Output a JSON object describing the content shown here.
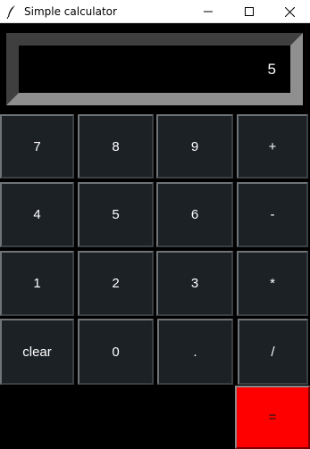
{
  "window": {
    "title": "Simple calculator"
  },
  "display": {
    "value": "5"
  },
  "keys": {
    "k7": "7",
    "k8": "8",
    "k9": "9",
    "plus": "+",
    "k4": "4",
    "k5": "5",
    "k6": "6",
    "minus": "-",
    "k1": "1",
    "k2": "2",
    "k3": "3",
    "multiply": "*",
    "clear": "clear",
    "k0": "0",
    "dot": ".",
    "divide": "/",
    "equals": "="
  },
  "colors": {
    "equals_button": "#ff0000",
    "key_background": "#1c2126",
    "window_background": "#000000"
  }
}
